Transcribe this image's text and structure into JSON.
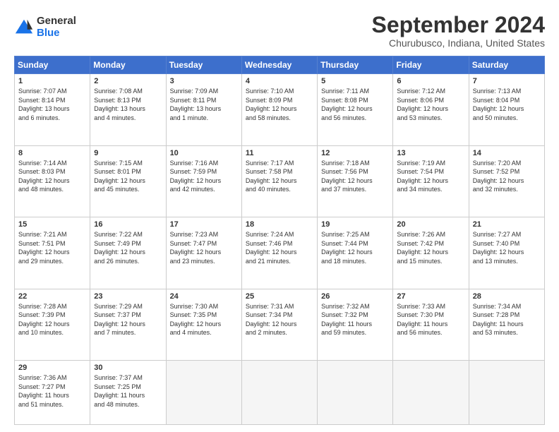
{
  "logo": {
    "general": "General",
    "blue": "Blue"
  },
  "title": "September 2024",
  "location": "Churubusco, Indiana, United States",
  "headers": [
    "Sunday",
    "Monday",
    "Tuesday",
    "Wednesday",
    "Thursday",
    "Friday",
    "Saturday"
  ],
  "weeks": [
    [
      {
        "day": "1",
        "info": "Sunrise: 7:07 AM\nSunset: 8:14 PM\nDaylight: 13 hours\nand 6 minutes."
      },
      {
        "day": "2",
        "info": "Sunrise: 7:08 AM\nSunset: 8:13 PM\nDaylight: 13 hours\nand 4 minutes."
      },
      {
        "day": "3",
        "info": "Sunrise: 7:09 AM\nSunset: 8:11 PM\nDaylight: 13 hours\nand 1 minute."
      },
      {
        "day": "4",
        "info": "Sunrise: 7:10 AM\nSunset: 8:09 PM\nDaylight: 12 hours\nand 58 minutes."
      },
      {
        "day": "5",
        "info": "Sunrise: 7:11 AM\nSunset: 8:08 PM\nDaylight: 12 hours\nand 56 minutes."
      },
      {
        "day": "6",
        "info": "Sunrise: 7:12 AM\nSunset: 8:06 PM\nDaylight: 12 hours\nand 53 minutes."
      },
      {
        "day": "7",
        "info": "Sunrise: 7:13 AM\nSunset: 8:04 PM\nDaylight: 12 hours\nand 50 minutes."
      }
    ],
    [
      {
        "day": "8",
        "info": "Sunrise: 7:14 AM\nSunset: 8:03 PM\nDaylight: 12 hours\nand 48 minutes."
      },
      {
        "day": "9",
        "info": "Sunrise: 7:15 AM\nSunset: 8:01 PM\nDaylight: 12 hours\nand 45 minutes."
      },
      {
        "day": "10",
        "info": "Sunrise: 7:16 AM\nSunset: 7:59 PM\nDaylight: 12 hours\nand 42 minutes."
      },
      {
        "day": "11",
        "info": "Sunrise: 7:17 AM\nSunset: 7:58 PM\nDaylight: 12 hours\nand 40 minutes."
      },
      {
        "day": "12",
        "info": "Sunrise: 7:18 AM\nSunset: 7:56 PM\nDaylight: 12 hours\nand 37 minutes."
      },
      {
        "day": "13",
        "info": "Sunrise: 7:19 AM\nSunset: 7:54 PM\nDaylight: 12 hours\nand 34 minutes."
      },
      {
        "day": "14",
        "info": "Sunrise: 7:20 AM\nSunset: 7:52 PM\nDaylight: 12 hours\nand 32 minutes."
      }
    ],
    [
      {
        "day": "15",
        "info": "Sunrise: 7:21 AM\nSunset: 7:51 PM\nDaylight: 12 hours\nand 29 minutes."
      },
      {
        "day": "16",
        "info": "Sunrise: 7:22 AM\nSunset: 7:49 PM\nDaylight: 12 hours\nand 26 minutes."
      },
      {
        "day": "17",
        "info": "Sunrise: 7:23 AM\nSunset: 7:47 PM\nDaylight: 12 hours\nand 23 minutes."
      },
      {
        "day": "18",
        "info": "Sunrise: 7:24 AM\nSunset: 7:46 PM\nDaylight: 12 hours\nand 21 minutes."
      },
      {
        "day": "19",
        "info": "Sunrise: 7:25 AM\nSunset: 7:44 PM\nDaylight: 12 hours\nand 18 minutes."
      },
      {
        "day": "20",
        "info": "Sunrise: 7:26 AM\nSunset: 7:42 PM\nDaylight: 12 hours\nand 15 minutes."
      },
      {
        "day": "21",
        "info": "Sunrise: 7:27 AM\nSunset: 7:40 PM\nDaylight: 12 hours\nand 13 minutes."
      }
    ],
    [
      {
        "day": "22",
        "info": "Sunrise: 7:28 AM\nSunset: 7:39 PM\nDaylight: 12 hours\nand 10 minutes."
      },
      {
        "day": "23",
        "info": "Sunrise: 7:29 AM\nSunset: 7:37 PM\nDaylight: 12 hours\nand 7 minutes."
      },
      {
        "day": "24",
        "info": "Sunrise: 7:30 AM\nSunset: 7:35 PM\nDaylight: 12 hours\nand 4 minutes."
      },
      {
        "day": "25",
        "info": "Sunrise: 7:31 AM\nSunset: 7:34 PM\nDaylight: 12 hours\nand 2 minutes."
      },
      {
        "day": "26",
        "info": "Sunrise: 7:32 AM\nSunset: 7:32 PM\nDaylight: 11 hours\nand 59 minutes."
      },
      {
        "day": "27",
        "info": "Sunrise: 7:33 AM\nSunset: 7:30 PM\nDaylight: 11 hours\nand 56 minutes."
      },
      {
        "day": "28",
        "info": "Sunrise: 7:34 AM\nSunset: 7:28 PM\nDaylight: 11 hours\nand 53 minutes."
      }
    ],
    [
      {
        "day": "29",
        "info": "Sunrise: 7:36 AM\nSunset: 7:27 PM\nDaylight: 11 hours\nand 51 minutes."
      },
      {
        "day": "30",
        "info": "Sunrise: 7:37 AM\nSunset: 7:25 PM\nDaylight: 11 hours\nand 48 minutes."
      },
      {
        "day": "",
        "info": ""
      },
      {
        "day": "",
        "info": ""
      },
      {
        "day": "",
        "info": ""
      },
      {
        "day": "",
        "info": ""
      },
      {
        "day": "",
        "info": ""
      }
    ]
  ]
}
